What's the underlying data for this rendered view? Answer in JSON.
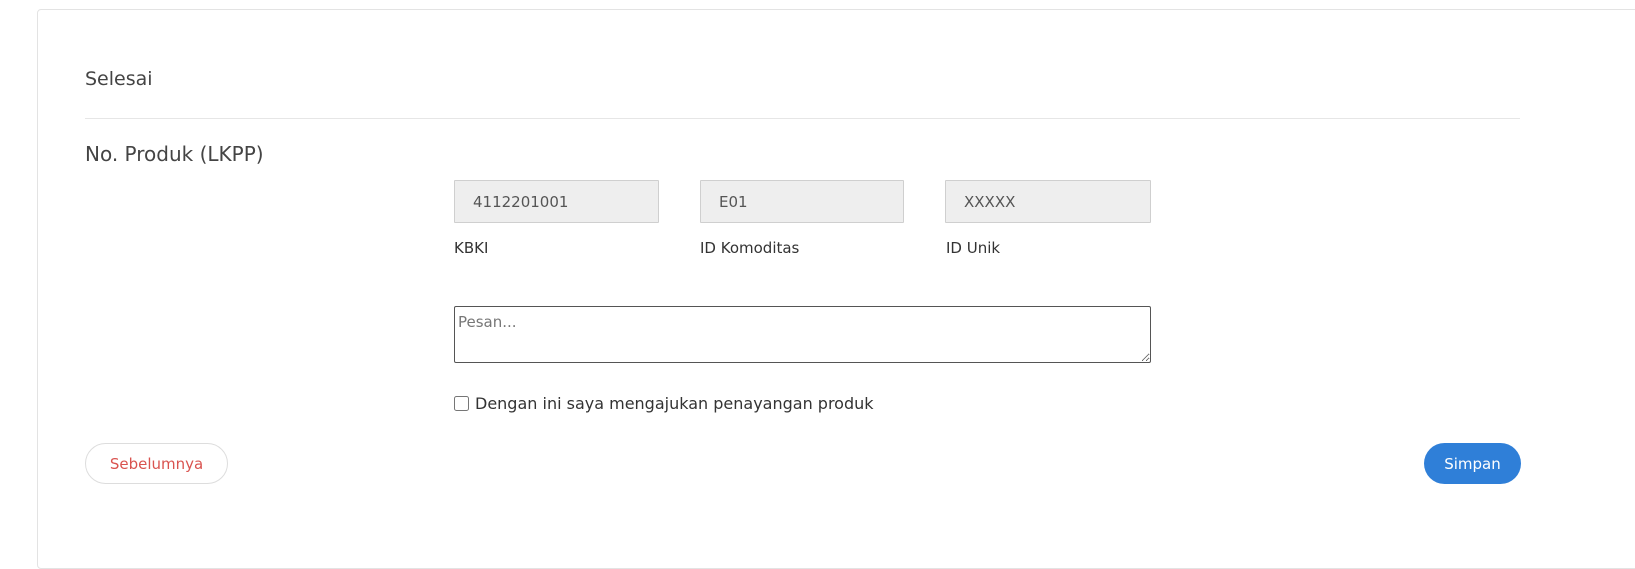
{
  "section": {
    "title": "Selesai"
  },
  "product_number": {
    "label": "No. Produk (LKPP)",
    "kbki": {
      "value": "4112201001",
      "label": "KBKI"
    },
    "komoditas": {
      "value": "E01",
      "label": "ID Komoditas"
    },
    "unik": {
      "value": "XXXXX",
      "label": "ID Unik"
    }
  },
  "message": {
    "placeholder": "Pesan..."
  },
  "agreement": {
    "label": "Dengan ini saya mengajukan penayangan produk",
    "checked": false
  },
  "actions": {
    "previous_label": "Sebelumnya",
    "save_label": "Simpan"
  },
  "colors": {
    "primary": "#2f7fd8",
    "danger": "#d9534f"
  }
}
